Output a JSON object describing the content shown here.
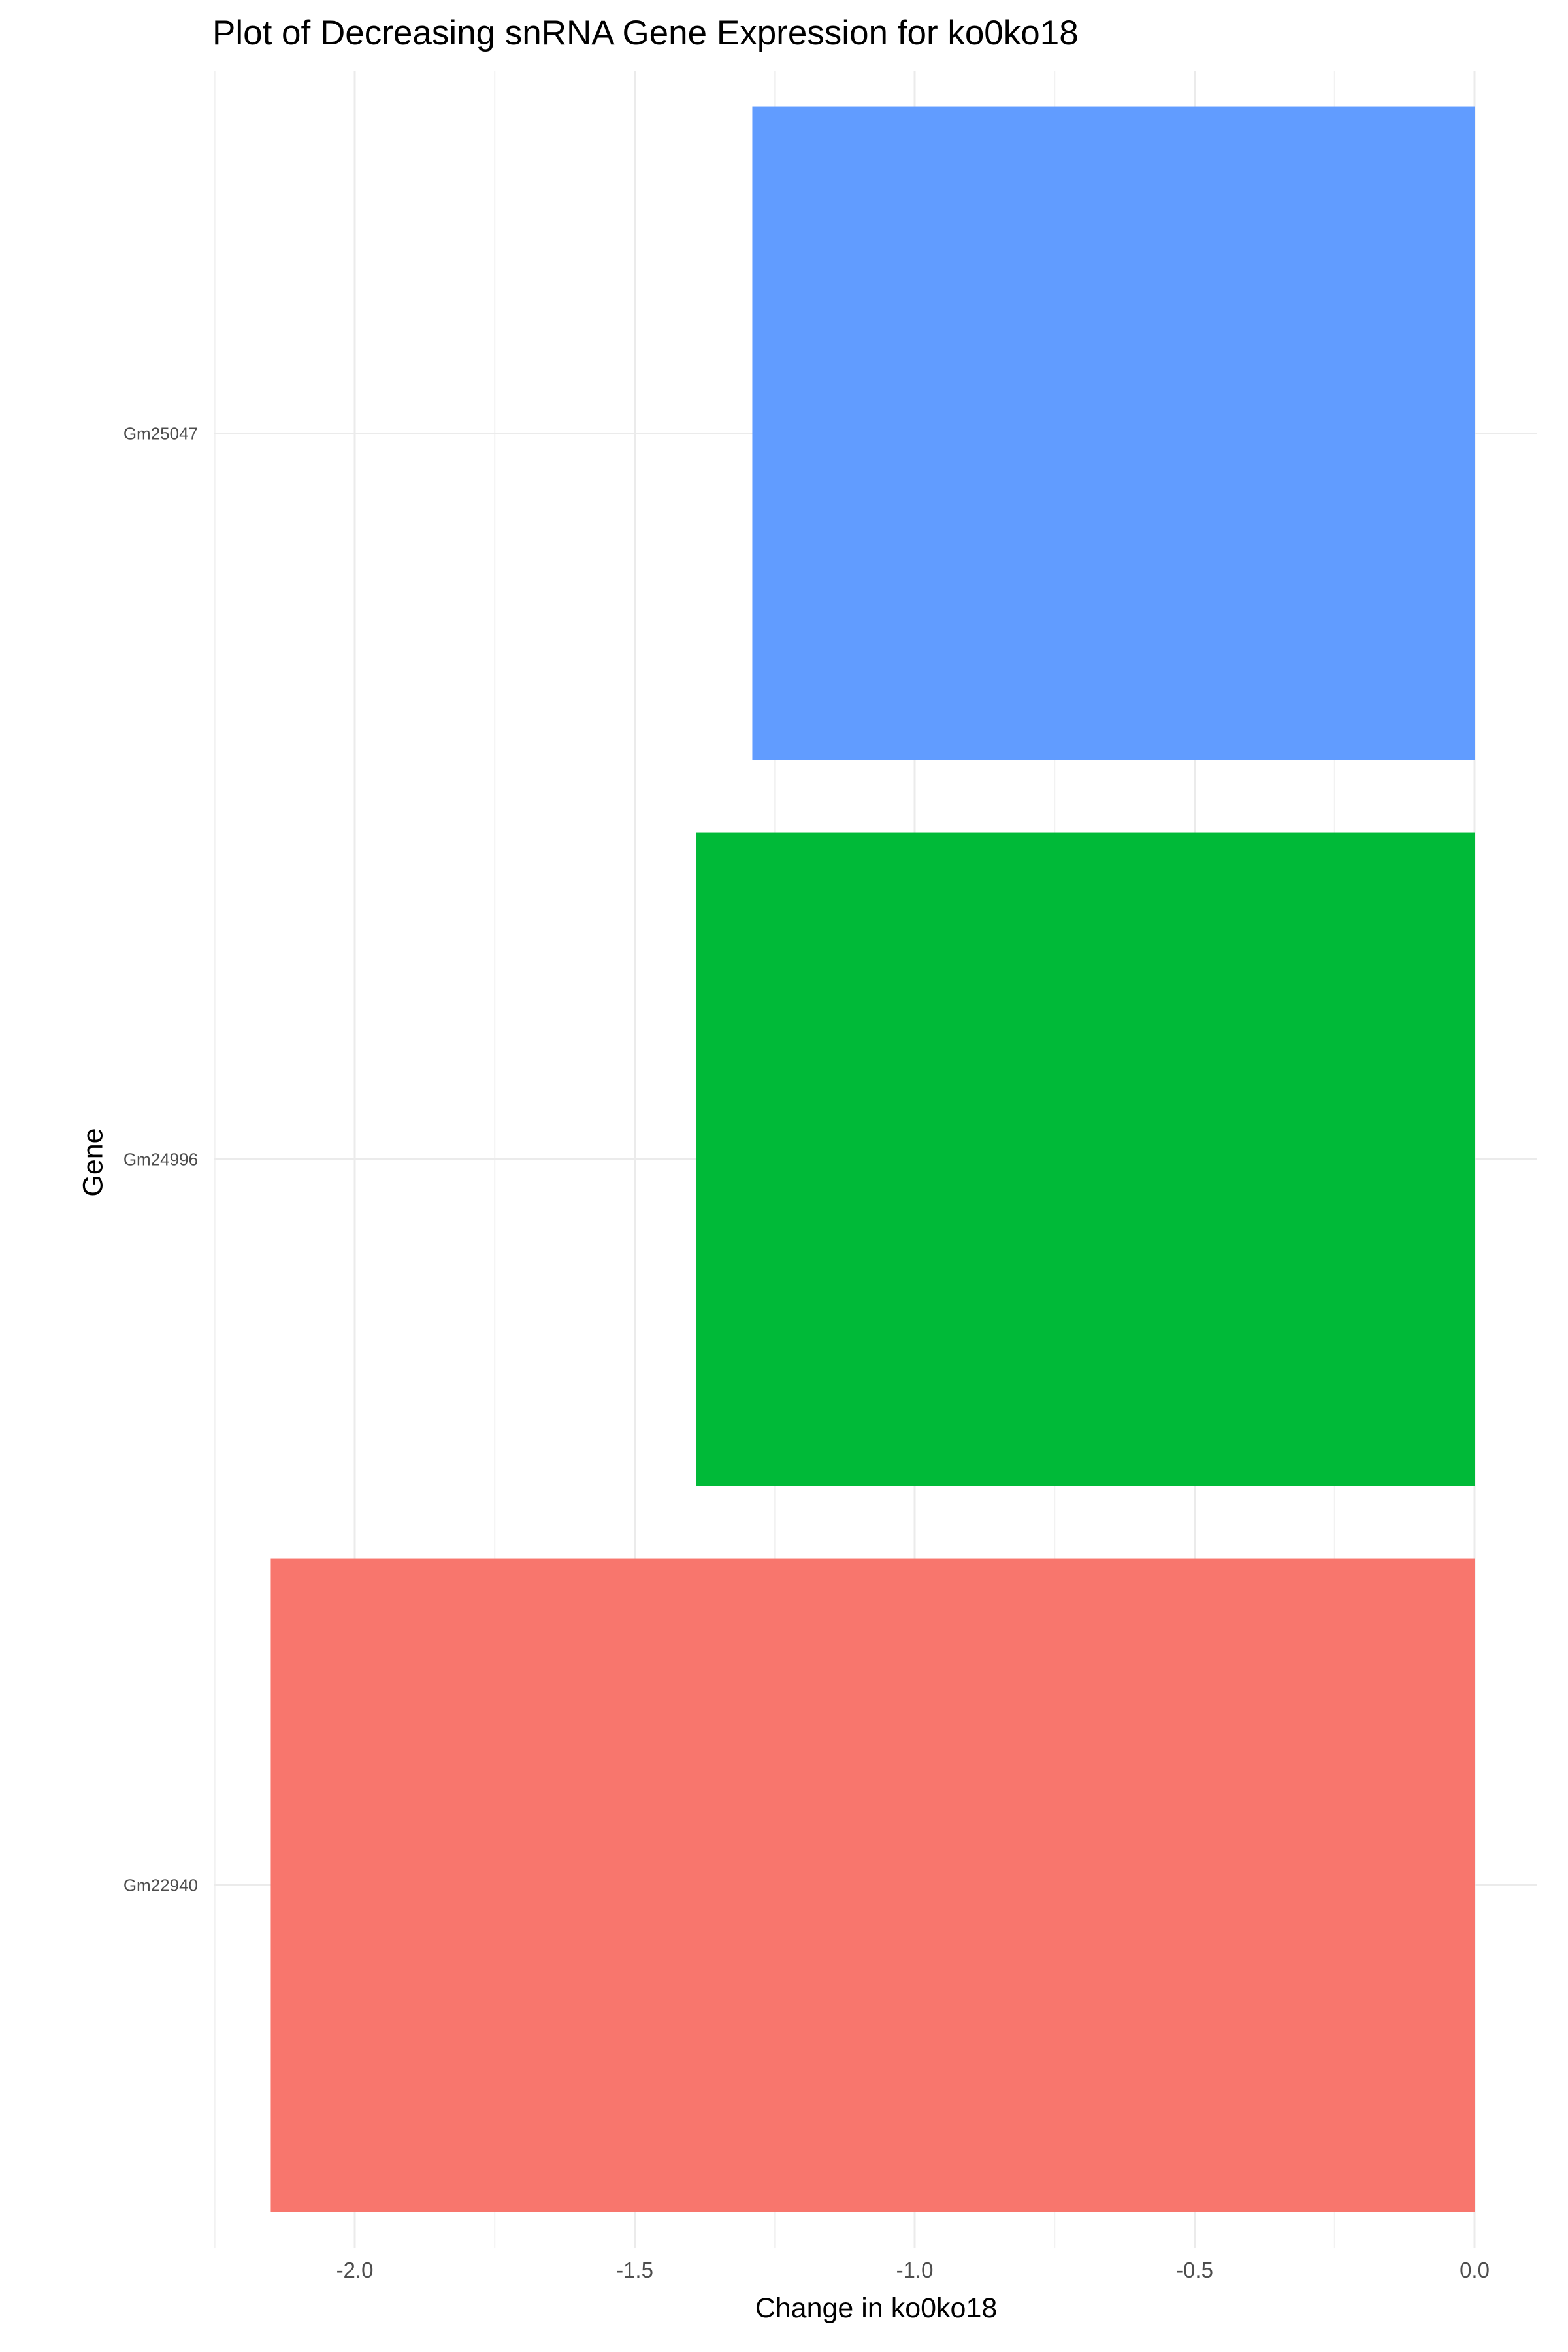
{
  "chart_data": {
    "type": "bar",
    "orientation": "horizontal",
    "title": "Plot of Decreasing snRNA Gene Expression for ko0ko18",
    "xlabel": "Change in ko0ko18",
    "ylabel": "Gene",
    "categories": [
      "Gm22940",
      "Gm24996",
      "Gm25047"
    ],
    "values": [
      -2.15,
      -1.39,
      -1.29
    ],
    "bar_colors": [
      "#F8766D",
      "#00BA38",
      "#619CFF"
    ],
    "xlim": [
      -2.25,
      0.1
    ],
    "x_ticks": [
      -2.0,
      -1.5,
      -1.0,
      -0.5,
      0.0
    ],
    "x_tick_labels": [
      "-2.0",
      "-1.5",
      "-1.0",
      "-0.5",
      "0.0"
    ],
    "grid": true,
    "legend": "none"
  }
}
